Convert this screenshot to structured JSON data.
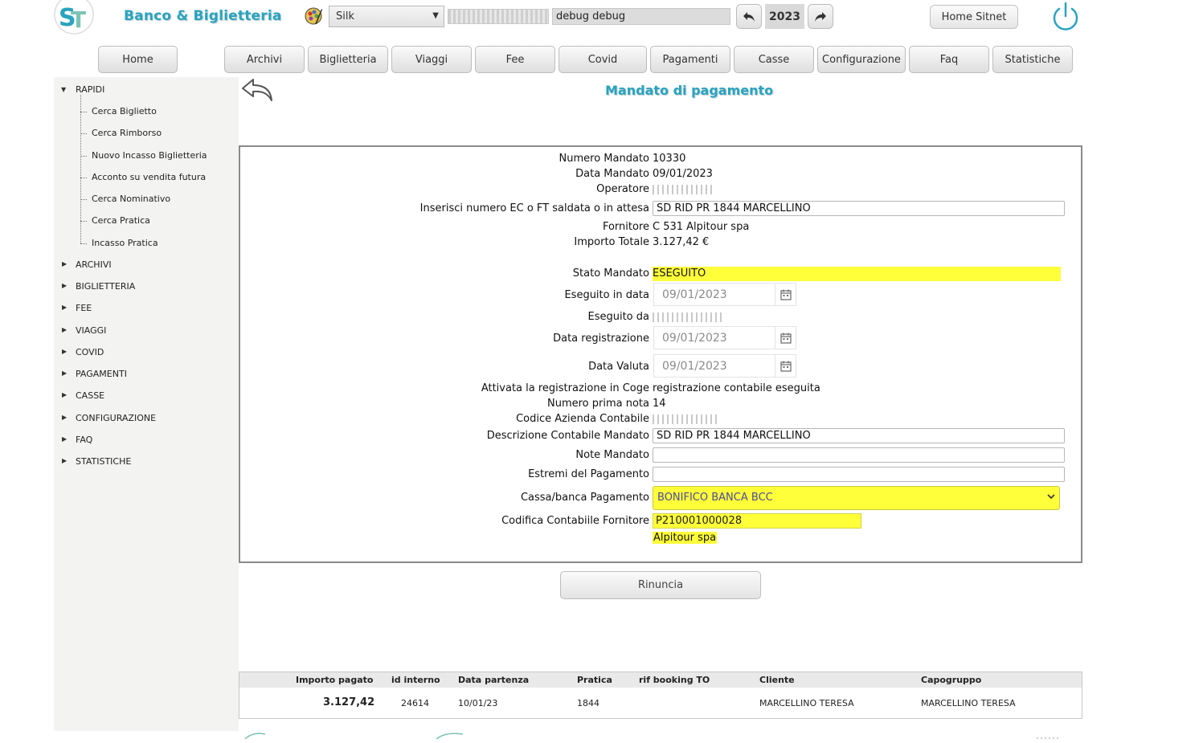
{
  "header": {
    "app_title": "Banco & Biglietteria",
    "theme_select": "Silk",
    "user": "debug debug",
    "year": "2023",
    "home_sitnet": "Home Sitnet"
  },
  "nav": [
    "Home",
    "Archivi",
    "Biglietteria",
    "Viaggi",
    "Fee",
    "Covid",
    "Pagamenti",
    "Casse",
    "Configurazione",
    "Faq",
    "Statistiche"
  ],
  "sidebar": {
    "rapidi": "RAPIDI",
    "rapidi_items": [
      "Cerca Biglietto",
      "Cerca Rimborso",
      "Nuovo Incasso Biglietteria",
      "Acconto su vendita futura",
      "Cerca Nominativo",
      "Cerca Pratica",
      "Incasso Pratica"
    ],
    "sections": [
      "ARCHIVI",
      "BIGLIETTERIA",
      "FEE",
      "VIAGGI",
      "COVID",
      "PAGAMENTI",
      "CASSE",
      "CONFIGURAZIONE",
      "FAQ",
      "STATISTICHE"
    ]
  },
  "page_title": "Mandato di pagamento",
  "form": {
    "numero_mandato_label": "Numero Mandato",
    "numero_mandato": "10330",
    "data_mandato_label": "Data Mandato",
    "data_mandato": "09/01/2023",
    "operatore_label": "Operatore",
    "inserisci_label": "Inserisci numero EC o FT saldata o in attesa",
    "inserisci_value": "SD RID PR 1844 MARCELLINO",
    "fornitore_label": "Fornitore",
    "fornitore": "C 531 Alpitour spa",
    "importo_totale_label": "Importo Totale",
    "importo_totale": "3.127,42 €",
    "stato_label": "Stato Mandato",
    "stato": "ESEGUITO",
    "eseguito_data_label": "Eseguito in data",
    "eseguito_data": "09/01/2023",
    "eseguito_da_label": "Eseguito da",
    "data_registrazione_label": "Data registrazione",
    "data_registrazione": "09/01/2023",
    "data_valuta_label": "Data Valuta",
    "data_valuta": "09/01/2023",
    "coge_label": "Attivata la registrazione in Coge",
    "coge_value": "registrazione contabile eseguita",
    "prima_nota_label": "Numero prima nota",
    "prima_nota": "14",
    "codice_azienda_label": "Codice Azienda Contabile",
    "descrizione_label": "Descrizione Contabile Mandato",
    "descrizione_value": "SD RID PR 1844 MARCELLINO",
    "note_label": "Note Mandato",
    "note_value": "",
    "estremi_label": "Estremi del Pagamento",
    "estremi_value": "",
    "cassa_label": "Cassa/banca Pagamento",
    "cassa_value": "BONIFICO BANCA BCC",
    "codifica_label": "Codifica Contabiile Fornitore",
    "codifica_value": "P210001000028",
    "codifica_nome": "Alpitour spa"
  },
  "rinuncia": "Rinuncia",
  "table": {
    "headers": [
      "Importo pagato",
      "id interno",
      "Data partenza",
      "Pratica",
      "rif booking TO",
      "Cliente",
      "Capogruppo"
    ],
    "row": [
      "3.127,42",
      "24614",
      "10/01/23",
      "1844",
      "",
      "MARCELLINO TERESA",
      "MARCELLINO TERESA"
    ]
  },
  "colors": {
    "accent": "#2aa3bf",
    "highlight": "#ffff3a",
    "sidebar_bg": "#f3f3f1"
  }
}
